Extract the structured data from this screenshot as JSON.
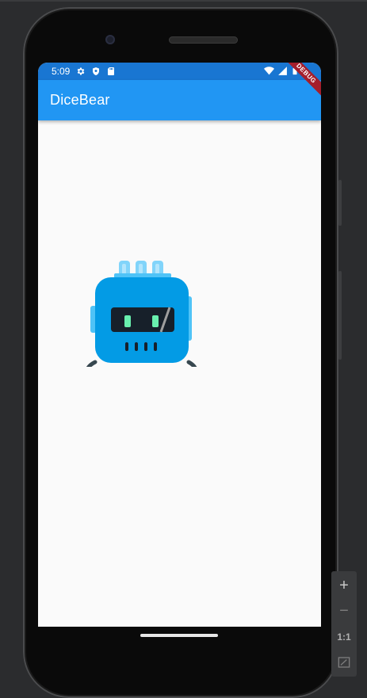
{
  "status_bar": {
    "time": "5:09",
    "left_icons": [
      "settings-icon",
      "shield-icon",
      "sd-card-icon"
    ],
    "right_icons": [
      "wifi-icon",
      "signal-icon",
      "battery-icon"
    ]
  },
  "app_bar": {
    "title": "DiceBear"
  },
  "debug_banner": {
    "label": "DEBUG"
  },
  "avatar": {
    "icon": "bottts-robot-avatar",
    "colors": {
      "body": "#039be5",
      "antenna": "#81d4fa",
      "visor": "#17202a",
      "eyes": "#69f0ae",
      "ears": "#37474f"
    }
  },
  "emulator_toolbar": {
    "zoom_in": "+",
    "zoom_out": "−",
    "actual_size": "1:1",
    "fit_icon": "fit-screen-icon"
  },
  "colors": {
    "status_bar": "#1976d2",
    "app_bar": "#2196f3",
    "background": "#fafafa"
  }
}
